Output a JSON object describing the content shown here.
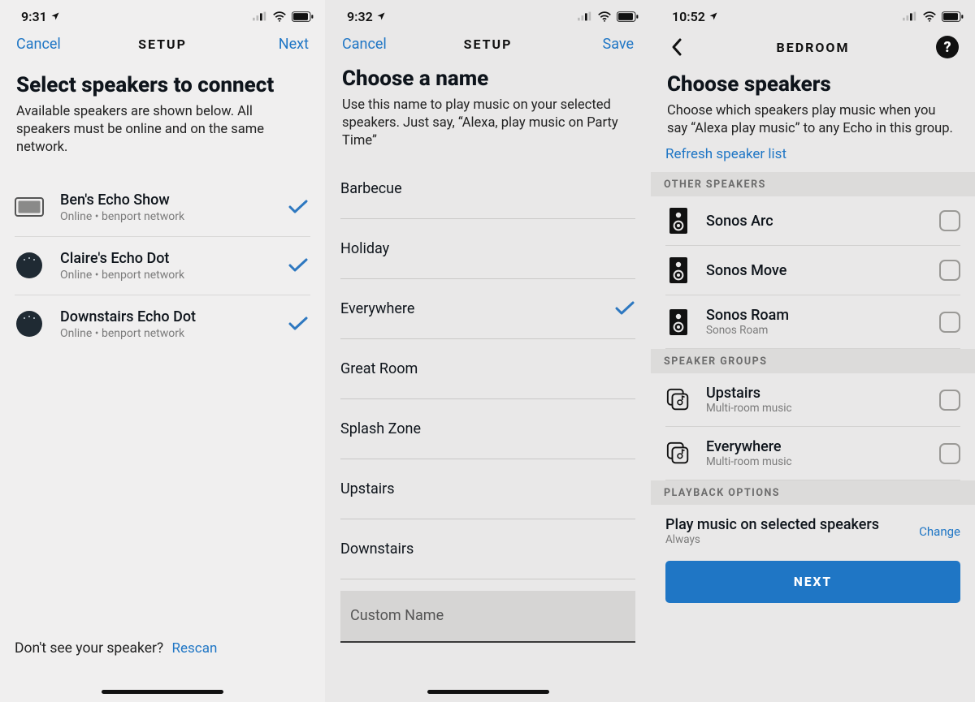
{
  "screens": [
    {
      "status_time": "9:31",
      "nav": {
        "left": "Cancel",
        "title": "SETUP",
        "right": "Next"
      },
      "title": "Select speakers to connect",
      "subtitle": "Available speakers are shown below. All speakers must be online and on the same network.",
      "speakers": [
        {
          "name": "Ben's Echo Show",
          "status": "Online • benport network",
          "icon": "echo-show",
          "selected": true
        },
        {
          "name": "Claire's Echo Dot",
          "status": "Online • benport network",
          "icon": "echo-dot-dark",
          "selected": true
        },
        {
          "name": "Downstairs Echo Dot",
          "status": "Online • benport network",
          "icon": "echo-dot-dark",
          "selected": true
        }
      ],
      "footer_text": "Don't see your speaker?",
      "footer_link": "Rescan"
    },
    {
      "status_time": "9:32",
      "nav": {
        "left": "Cancel",
        "title": "SETUP",
        "right": "Save"
      },
      "title": "Choose a name",
      "subtitle": "Use this name to play music on your selected speakers. Just say, “Alexa, play music on Party Time”",
      "names": [
        {
          "label": "Barbecue",
          "selected": false
        },
        {
          "label": "Holiday",
          "selected": false
        },
        {
          "label": "Everywhere",
          "selected": true
        },
        {
          "label": "Great Room",
          "selected": false
        },
        {
          "label": "Splash Zone",
          "selected": false
        },
        {
          "label": "Upstairs",
          "selected": false
        },
        {
          "label": "Downstairs",
          "selected": false
        }
      ],
      "custom_placeholder": "Custom Name"
    },
    {
      "status_time": "10:52",
      "nav": {
        "title": "BEDROOM"
      },
      "title": "Choose speakers",
      "subtitle": "Choose which speakers play music when you say “Alexa play music” to any Echo in this group.",
      "refresh_label": "Refresh speaker list",
      "section_other": "OTHER SPEAKERS",
      "other_speakers": [
        {
          "name": "Sonos Arc",
          "sub": "",
          "checked": false
        },
        {
          "name": "Sonos Move",
          "sub": "",
          "checked": false
        },
        {
          "name": "Sonos Roam",
          "sub": "Sonos Roam",
          "checked": false
        }
      ],
      "section_groups": "SPEAKER GROUPS",
      "groups": [
        {
          "name": "Upstairs",
          "sub": "Multi-room music",
          "checked": false
        },
        {
          "name": "Everywhere",
          "sub": "Multi-room music",
          "checked": false
        }
      ],
      "section_playback": "PLAYBACK OPTIONS",
      "playback_label": "Play music on selected speakers",
      "playback_value": "Always",
      "playback_change": "Change",
      "next_button": "NEXT"
    }
  ]
}
